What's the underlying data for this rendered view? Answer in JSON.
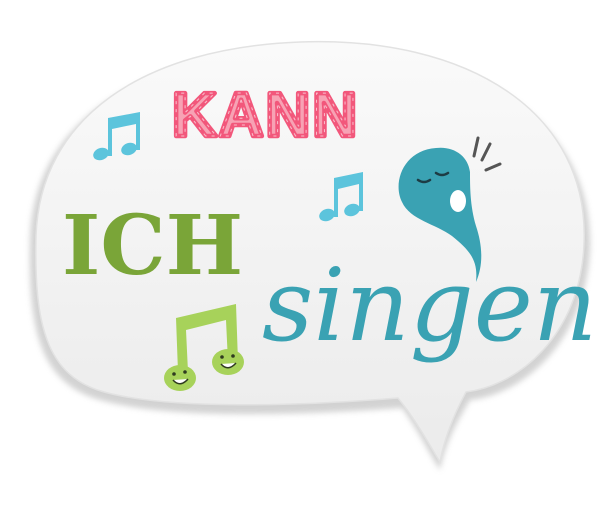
{
  "headline": {
    "word1": "KANN",
    "word2": "ICH",
    "word3": "singen"
  },
  "colors": {
    "pink": "#f2577b",
    "green": "#7aa538",
    "teal": "#3aa2b3",
    "light_blue": "#5cc4dc",
    "lime": "#a7d25a",
    "bubble": "#f2f2f2",
    "bubble_edge": "#d2d2d2"
  },
  "icons": [
    "speech-bubble",
    "music-note-icon",
    "singing-note-character-icon",
    "smiling-double-note-icon"
  ]
}
